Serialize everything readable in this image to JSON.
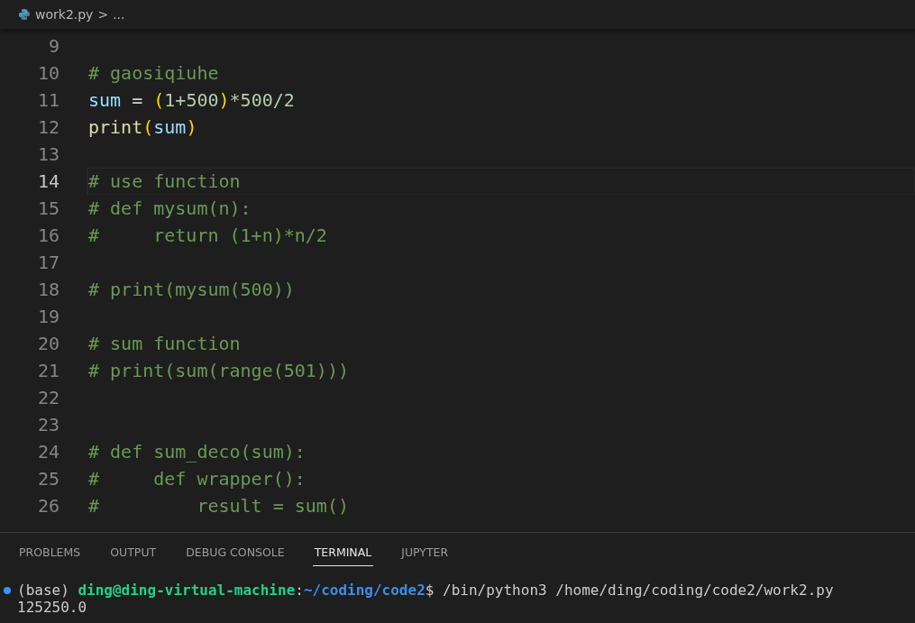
{
  "breadcrumb": {
    "file": "work2.py",
    "separator": ">",
    "rest": "..."
  },
  "editor": {
    "lines": [
      {
        "number": "9",
        "current": false
      },
      {
        "number": "10",
        "current": false,
        "tokens": [
          {
            "kind": "comment",
            "text": "# gaosiqiuhe"
          }
        ]
      },
      {
        "number": "11",
        "current": false,
        "tokens": [
          {
            "kind": "variable",
            "text": "sum"
          },
          {
            "kind": "operator",
            "text": " = "
          },
          {
            "kind": "bracket",
            "text": "("
          },
          {
            "kind": "number",
            "text": "1+500"
          },
          {
            "kind": "bracket",
            "text": ")"
          },
          {
            "kind": "number",
            "text": "*500/2"
          }
        ]
      },
      {
        "number": "12",
        "current": false,
        "tokens": [
          {
            "kind": "function",
            "text": "print"
          },
          {
            "kind": "bracket",
            "text": "("
          },
          {
            "kind": "variable",
            "text": "sum"
          },
          {
            "kind": "bracket",
            "text": ")"
          }
        ]
      },
      {
        "number": "13",
        "current": false
      },
      {
        "number": "14",
        "current": true,
        "tokens": [
          {
            "kind": "comment",
            "text": "# use function"
          }
        ]
      },
      {
        "number": "15",
        "current": false,
        "tokens": [
          {
            "kind": "comment",
            "text": "# def mysum(n):"
          }
        ]
      },
      {
        "number": "16",
        "current": false,
        "tokens": [
          {
            "kind": "comment",
            "text": "#     return (1+n)*n/2"
          }
        ]
      },
      {
        "number": "17",
        "current": false
      },
      {
        "number": "18",
        "current": false,
        "tokens": [
          {
            "kind": "comment",
            "text": "# print(mysum(500))"
          }
        ]
      },
      {
        "number": "19",
        "current": false
      },
      {
        "number": "20",
        "current": false,
        "tokens": [
          {
            "kind": "comment",
            "text": "# sum function"
          }
        ]
      },
      {
        "number": "21",
        "current": false,
        "tokens": [
          {
            "kind": "comment",
            "text": "# print(sum(range(501)))"
          }
        ]
      },
      {
        "number": "22",
        "current": false
      },
      {
        "number": "23",
        "current": false
      },
      {
        "number": "24",
        "current": false,
        "tokens": [
          {
            "kind": "comment",
            "text": "# def sum_deco(sum):"
          }
        ]
      },
      {
        "number": "25",
        "current": false,
        "tokens": [
          {
            "kind": "comment",
            "text": "#     def wrapper():"
          }
        ]
      },
      {
        "number": "26",
        "current": false,
        "tokens": [
          {
            "kind": "comment",
            "text": "#         result = sum()"
          }
        ]
      }
    ]
  },
  "panel": {
    "tabs": [
      {
        "label": "PROBLEMS",
        "selected": false
      },
      {
        "label": "OUTPUT",
        "selected": false
      },
      {
        "label": "DEBUG CONSOLE",
        "selected": false
      },
      {
        "label": "TERMINAL",
        "selected": true
      },
      {
        "label": "JUPYTER",
        "selected": false
      }
    ],
    "terminal": {
      "env": "(base)",
      "user": "ding@ding-virtual-machine",
      "colon": ":",
      "path": "~/coding/code2",
      "prompt": "$",
      "command": "/bin/python3 /home/ding/coding/code2/work2.py",
      "output": "125250.0"
    }
  }
}
